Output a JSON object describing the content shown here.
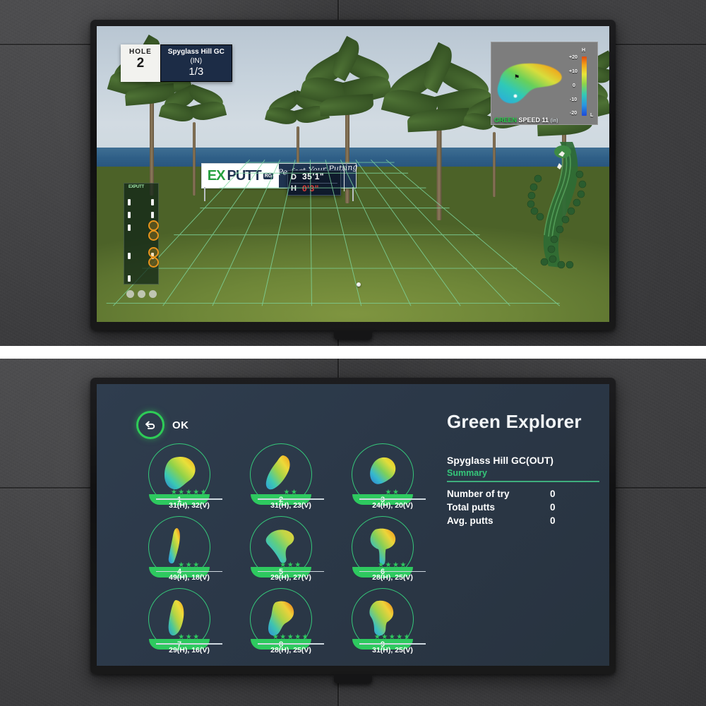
{
  "sim": {
    "header": {
      "hole_label": "HOLE",
      "hole_number": "2",
      "course_name": "Spyglass Hill GC",
      "course_side": "(IN)",
      "hole_progress": "1/3"
    },
    "banner": {
      "brand_ex": "EX",
      "brand_putt": "PUTT",
      "brand_badge": "RG",
      "tagline": "Perfect Your Putting"
    },
    "distance": {
      "d_label": "D",
      "d_value": "35'1\"",
      "h_label": "H",
      "h_value": "0'3\"",
      "h_color": "#e03a35",
      "d_color": "#ffffff"
    },
    "minimap": {
      "high_label": "H",
      "low_label": "L",
      "scale_ticks": [
        "+20",
        "+10",
        "0",
        "-10",
        "-20"
      ],
      "green_label": "GREEN",
      "speed_label": "SPEED 11",
      "unit_label": "(in)"
    }
  },
  "explorer": {
    "back_button": "OK",
    "title": "Green Explorer",
    "course": "Spyglass Hill GC(OUT)",
    "summary_label": "Summary",
    "stats": [
      {
        "key": "Number of try",
        "value": "0"
      },
      {
        "key": "Total putts",
        "value": "0"
      },
      {
        "key": "Avg. putts",
        "value": "0"
      }
    ],
    "accent": "#35c77a",
    "holes": [
      {
        "number": "1",
        "stars": 5,
        "dims": "31(H), 32(V)"
      },
      {
        "number": "2",
        "stars": 2,
        "dims": "31(H), 23(V)"
      },
      {
        "number": "3",
        "stars": 2,
        "dims": "24(H), 20(V)"
      },
      {
        "number": "4",
        "stars": 3,
        "dims": "49(H), 18(V)"
      },
      {
        "number": "5",
        "stars": 3,
        "dims": "29(H), 27(V)"
      },
      {
        "number": "6",
        "stars": 4,
        "dims": "28(H), 25(V)"
      },
      {
        "number": "7",
        "stars": 3,
        "dims": "29(H), 16(V)"
      },
      {
        "number": "8",
        "stars": 5,
        "dims": "28(H), 25(V)"
      },
      {
        "number": "9",
        "stars": 5,
        "dims": "31(H), 25(V)"
      }
    ]
  }
}
